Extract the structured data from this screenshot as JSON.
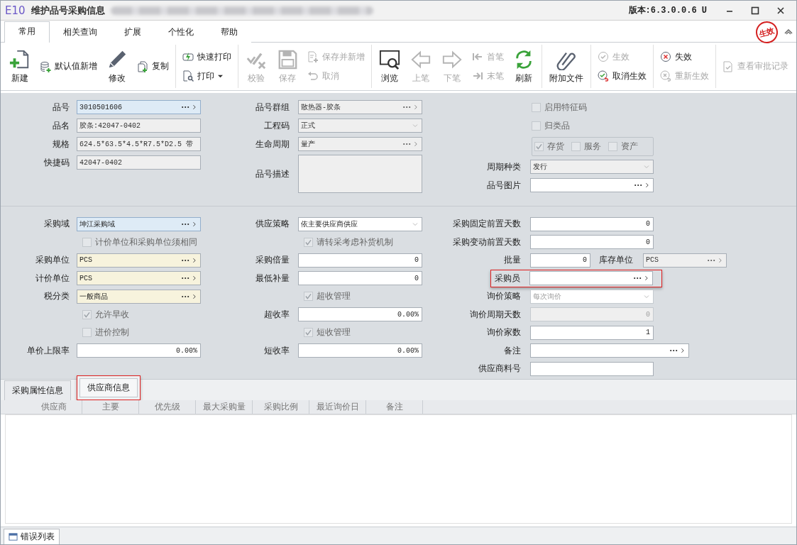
{
  "window": {
    "logo": "E10",
    "title": "维护品号采购信息",
    "version": "版本:6.3.0.0.6 U"
  },
  "ribbon_tabs": [
    {
      "label": "常用",
      "selected": true
    },
    {
      "label": "相关查询",
      "selected": false
    },
    {
      "label": "扩展",
      "selected": false
    },
    {
      "label": "个性化",
      "selected": false
    },
    {
      "label": "帮助",
      "selected": false
    }
  ],
  "status_stamp": "生效",
  "toolbar": {
    "groups": [
      {
        "items": [
          {
            "kind": "large",
            "label": "新建",
            "disabled": false
          },
          {
            "kind": "inline",
            "label": "默认值新增",
            "disabled": false
          },
          {
            "kind": "large",
            "label": "修改",
            "disabled": false
          },
          {
            "kind": "inline",
            "label": "复制",
            "disabled": false
          }
        ]
      },
      {
        "items": [
          {
            "kind": "stack",
            "items": [
              {
                "label": "快速打印",
                "disabled": false,
                "has_menu": false
              },
              {
                "label": "打印",
                "disabled": false,
                "has_menu": true
              }
            ]
          }
        ]
      },
      {
        "items": [
          {
            "kind": "large",
            "label": "校验",
            "disabled": true
          },
          {
            "kind": "large",
            "label": "保存",
            "disabled": true
          },
          {
            "kind": "stack",
            "items": [
              {
                "label": "保存并新增",
                "disabled": true,
                "has_menu": false
              },
              {
                "label": "取消",
                "disabled": true,
                "has_menu": false
              }
            ]
          }
        ]
      },
      {
        "items": [
          {
            "kind": "large",
            "label": "浏览",
            "disabled": false
          },
          {
            "kind": "large",
            "label": "上笔",
            "disabled": true
          },
          {
            "kind": "large",
            "label": "下笔",
            "disabled": true
          },
          {
            "kind": "stack",
            "items": [
              {
                "label": "首笔",
                "disabled": true,
                "has_menu": false
              },
              {
                "label": "末笔",
                "disabled": true,
                "has_menu": false
              }
            ]
          },
          {
            "kind": "large",
            "label": "刷新",
            "disabled": false
          }
        ]
      },
      {
        "items": [
          {
            "kind": "large",
            "label": "附加文件",
            "disabled": false
          }
        ]
      },
      {
        "items": [
          {
            "kind": "stack",
            "items": [
              {
                "label": "生效",
                "disabled": true,
                "has_menu": false
              },
              {
                "label": "取消生效",
                "disabled": false,
                "has_menu": false
              }
            ]
          }
        ]
      },
      {
        "items": [
          {
            "kind": "stack",
            "items": [
              {
                "label": "失效",
                "disabled": false,
                "has_menu": false
              },
              {
                "label": "重新生效",
                "disabled": true,
                "has_menu": false
              }
            ]
          }
        ]
      },
      {
        "items": [
          {
            "kind": "inline",
            "label": "查看审批记录",
            "disabled": true
          }
        ]
      }
    ]
  },
  "form": {
    "sections": [
      {
        "columns": [
          [
            {
              "kind": "lookup",
              "label": "品号",
              "value": "3010501606",
              "key": true,
              "required": false,
              "readonly": false,
              "disabled": false
            },
            {
              "kind": "text",
              "label": "品名",
              "value": "胶条:42047-0402",
              "key": false,
              "required": false,
              "readonly": true,
              "disabled": false
            },
            {
              "kind": "text",
              "label": "规格",
              "value": "624.5*63.5*4.5*R7.5*D2.5 带",
              "key": false,
              "required": false,
              "readonly": true,
              "disabled": false
            },
            {
              "kind": "text",
              "label": "快捷码",
              "value": "42047-0402",
              "key": false,
              "required": false,
              "readonly": true,
              "disabled": false
            }
          ],
          [
            {
              "kind": "lookup",
              "label": "品号群组",
              "value": "散热器-胶条",
              "key": false,
              "required": false,
              "readonly": true,
              "disabled": false
            },
            {
              "kind": "dropdown",
              "label": "工程码",
              "value": "正式",
              "key": false,
              "required": false,
              "readonly": true,
              "disabled": false
            },
            {
              "kind": "lookup",
              "label": "生命周期",
              "value": "量产",
              "key": false,
              "required": false,
              "readonly": true,
              "disabled": false
            },
            {
              "kind": "textarea",
              "label": "品号描述",
              "key": false,
              "required": false,
              "readonly": true,
              "disabled": false
            }
          ],
          [
            {
              "kind": "checkbox",
              "label": "启用特征码",
              "checked": false,
              "disabled": true
            },
            {
              "kind": "checkbox",
              "label": "归类品",
              "checked": false,
              "disabled": true
            },
            {
              "kind": "checkgroup",
              "items": [
                {
                  "label": "存货",
                  "checked": true,
                  "disabled": true
                },
                {
                  "label": "服务",
                  "checked": false,
                  "disabled": true
                },
                {
                  "label": "资产",
                  "checked": false,
                  "disabled": true
                }
              ]
            },
            {
              "kind": "dropdown",
              "label": "周期种类",
              "value": "发行",
              "key": false,
              "required": false,
              "readonly": true,
              "disabled": false
            },
            {
              "kind": "lookup",
              "label": "品号图片",
              "key": false,
              "required": false,
              "readonly": false,
              "disabled": false
            }
          ]
        ]
      },
      {
        "columns": [
          [
            {
              "kind": "lookup",
              "label": "采购域",
              "value": "坤江采购域",
              "key": true,
              "required": false,
              "readonly": false,
              "disabled": false
            },
            {
              "kind": "checkbox",
              "label": "计价单位和采购单位须相同",
              "checked": false,
              "disabled": true
            },
            {
              "kind": "lookup",
              "label": "采购单位",
              "value": "PCS",
              "key": false,
              "required": true,
              "readonly": false,
              "disabled": false
            },
            {
              "kind": "lookup",
              "label": "计价单位",
              "value": "PCS",
              "key": false,
              "required": true,
              "readonly": false,
              "disabled": false
            },
            {
              "kind": "lookup",
              "label": "税分类",
              "value": "一般商品",
              "key": false,
              "required": true,
              "readonly": false,
              "disabled": false
            },
            {
              "kind": "checkbox",
              "label": "允许早收",
              "checked": true,
              "disabled": true
            },
            {
              "kind": "checkbox",
              "label": "进价控制",
              "checked": false,
              "disabled": true
            },
            {
              "kind": "number",
              "label": "单价上限率",
              "value": "0.00%",
              "key": false,
              "required": false,
              "readonly": false,
              "disabled": false
            }
          ],
          [
            {
              "kind": "dropdown",
              "label": "供应策略",
              "value": "依主要供应商供应",
              "key": false,
              "required": false,
              "readonly": false,
              "disabled": false
            },
            {
              "kind": "checkbox",
              "label": "请转采考虑补货机制",
              "checked": true,
              "disabled": true
            },
            {
              "kind": "number",
              "label": "采购倍量",
              "value": "0",
              "key": false,
              "required": false,
              "readonly": false,
              "disabled": false
            },
            {
              "kind": "number",
              "label": "最低补量",
              "value": "0",
              "key": false,
              "required": false,
              "readonly": false,
              "disabled": false
            },
            {
              "kind": "checkbox",
              "label": "超收管理",
              "checked": true,
              "disabled": true
            },
            {
              "kind": "number",
              "label": "超收率",
              "value": "0.00%",
              "key": false,
              "required": false,
              "readonly": false,
              "disabled": false
            },
            {
              "kind": "checkbox",
              "label": "短收管理",
              "checked": true,
              "disabled": true
            },
            {
              "kind": "number",
              "label": "短收率",
              "value": "0.00%",
              "key": false,
              "required": false,
              "readonly": false,
              "disabled": false
            }
          ],
          [
            {
              "kind": "number",
              "label": "采购固定前置天数",
              "value": "0",
              "key": false,
              "required": false,
              "readonly": false,
              "disabled": false,
              "highlighted": false
            },
            {
              "kind": "number",
              "label": "采购变动前置天数",
              "value": "0",
              "key": false,
              "required": false,
              "readonly": false,
              "disabled": false,
              "highlighted": false
            },
            {
              "kind": "short-number",
              "label": "批量",
              "value": "0",
              "key": false,
              "required": false,
              "readonly": false,
              "disabled": false,
              "highlighted": false,
              "extra": {
                "kind": "lookup",
                "label": "库存单位",
                "value": "PCS",
                "key": false,
                "required": false,
                "readonly": true,
                "disabled": false
              }
            },
            {
              "kind": "lookup",
              "label": "采购员",
              "key": false,
              "required": false,
              "readonly": false,
              "disabled": false,
              "highlighted": true
            },
            {
              "kind": "dropdown",
              "label": "询价策略",
              "value": "每次询价",
              "key": false,
              "required": false,
              "readonly": false,
              "disabled": true,
              "highlighted": false
            },
            {
              "kind": "number",
              "label": "询价周期天数",
              "value": "0",
              "key": false,
              "required": false,
              "readonly": true,
              "disabled": true,
              "highlighted": false
            },
            {
              "kind": "number",
              "label": "询价家数",
              "value": "1",
              "key": false,
              "required": false,
              "readonly": false,
              "disabled": false,
              "highlighted": false
            },
            {
              "kind": "wide-lookup",
              "label": "备注",
              "key": false,
              "required": false,
              "readonly": false,
              "disabled": false,
              "highlighted": false
            },
            {
              "kind": "text",
              "label": "供应商料号",
              "key": false,
              "required": false,
              "readonly": false,
              "disabled": false,
              "highlighted": false
            }
          ]
        ]
      }
    ]
  },
  "detail_tabs": [
    {
      "label": "采购属性信息",
      "selected": false,
      "highlighted": false
    },
    {
      "label": "供应商信息",
      "selected": true,
      "highlighted": true
    }
  ],
  "grid": {
    "columns": [
      "供应商",
      "主要",
      "优先级",
      "最大采购量",
      "采购比例",
      "最近询价日",
      "备注"
    ]
  },
  "status_bar": {
    "tabs": [
      {
        "label": "错误列表"
      }
    ]
  }
}
